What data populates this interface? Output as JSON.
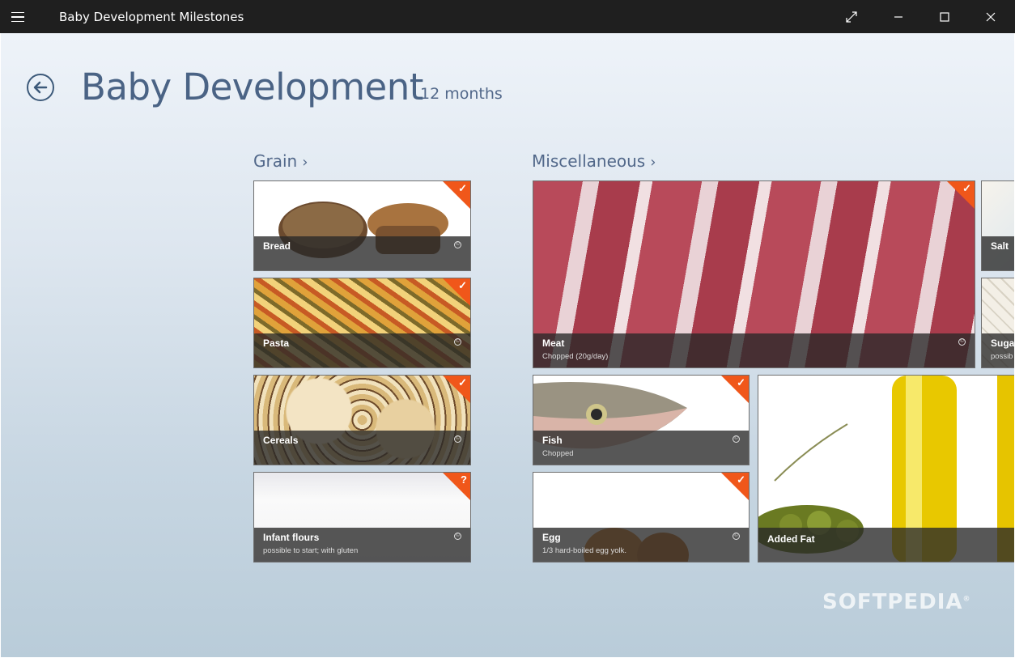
{
  "window": {
    "title": "Baby Development Milestones",
    "controls": {
      "menu": "≡",
      "fullscreen": "⤢",
      "minimize": "—",
      "maximize": "☐",
      "close": "✕"
    }
  },
  "header": {
    "back_icon": "←",
    "title": "Baby Development",
    "subtitle": "12 months"
  },
  "groups": [
    {
      "label": "Grain",
      "chevron": "›"
    },
    {
      "label": "Miscellaneous",
      "chevron": "›"
    }
  ],
  "tiles": {
    "bread": {
      "name": "Bread",
      "note": "",
      "status": "✓"
    },
    "pasta": {
      "name": "Pasta",
      "note": "",
      "status": "✓"
    },
    "cereals": {
      "name": "Cereals",
      "note": "",
      "status": "✓"
    },
    "infant_flours": {
      "name": "Infant flours",
      "note": "possible to start; with gluten",
      "status": "?"
    },
    "meat": {
      "name": "Meat",
      "note": "Chopped (20g/day)",
      "status": "✓"
    },
    "fish": {
      "name": "Fish",
      "note": "Chopped",
      "status": "✓"
    },
    "egg": {
      "name": "Egg",
      "note": "1/3 hard-boiled egg yolk.",
      "status": "✓"
    },
    "added_fat": {
      "name": "Added Fat",
      "note": ""
    },
    "salt": {
      "name": "Salt",
      "note": ""
    },
    "sugar": {
      "name": "Suga",
      "note": "possib"
    }
  },
  "info_glyph": "©",
  "watermark": {
    "text": "SOFTPEDIA",
    "mark": "®"
  },
  "colors": {
    "accent": "#f0571a",
    "title": "#4a6385",
    "caption_bg": "#282828"
  }
}
